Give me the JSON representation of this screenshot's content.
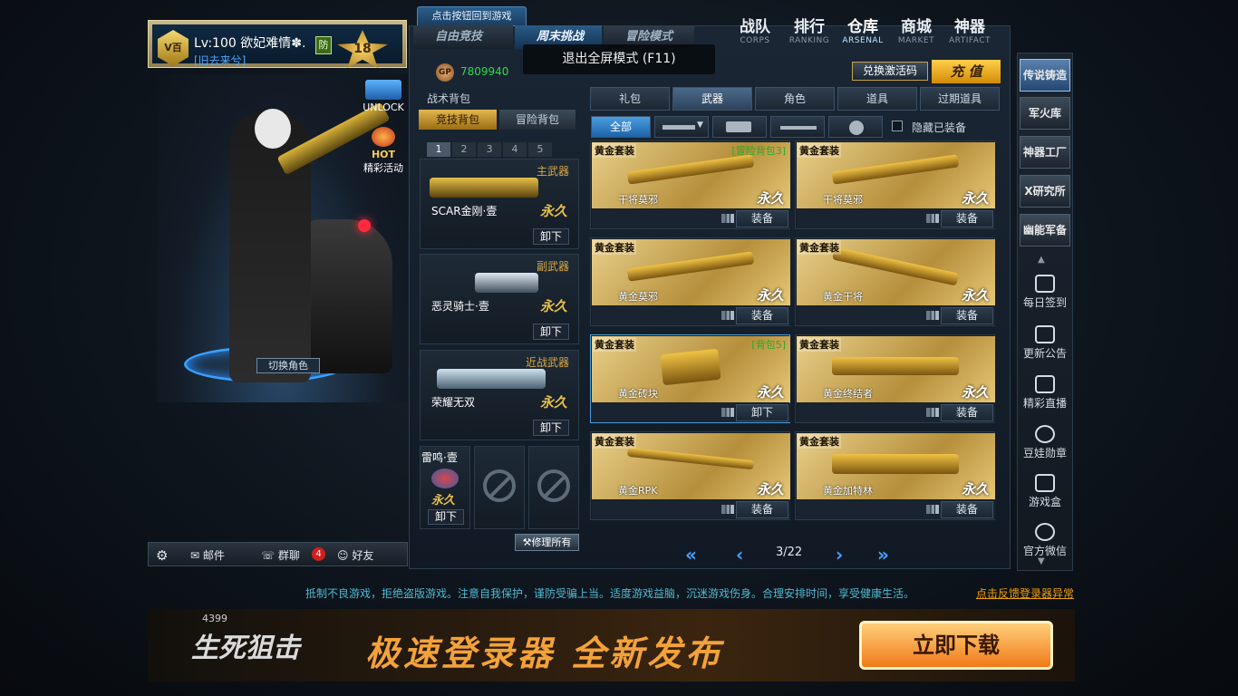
{
  "profile": {
    "rank_label": "V百",
    "level": "Lv:100 欲妃难情✽.",
    "subtitle": "[旧去来兮]",
    "fang": "防",
    "star": "18"
  },
  "left_icons": {
    "unlock": "UNLOCK",
    "hot": "HOT",
    "hot_label": "精彩活动"
  },
  "switch_role": "切换角色",
  "leftbar": {
    "mail": "邮件",
    "group": "群聊",
    "group_count": "4",
    "friends": "好友"
  },
  "tooltip": "点击按钮回到游戏",
  "mode_tabs": [
    "自由竞技",
    "周末挑战",
    "冒险模式"
  ],
  "fullscreen_msg": "退出全屏模式 (F11)",
  "nav": [
    {
      "cn": "战队",
      "en": "CORPS"
    },
    {
      "cn": "排行",
      "en": "RANKING"
    },
    {
      "cn": "仓库",
      "en": "ARSENAL"
    },
    {
      "cn": "商城",
      "en": "MARKET"
    },
    {
      "cn": "神器",
      "en": "ARTIFACT"
    }
  ],
  "currency": {
    "gp": "GP",
    "amount": "7809940"
  },
  "redeem": "兑换激活码",
  "recharge": "充 值",
  "tabs": [
    "礼包",
    "武器",
    "角色",
    "道具",
    "过期道具"
  ],
  "filter": {
    "all": "全部",
    "hide": "隐藏已装备"
  },
  "backpack": {
    "title": "战术背包",
    "tabs": [
      "竞技背包",
      "冒险背包"
    ],
    "pages": [
      "1",
      "2",
      "3",
      "4",
      "5"
    ],
    "slots": [
      {
        "cat": "主武器",
        "name": "SCAR金刚·壹",
        "forever": "永久",
        "btn": "卸下"
      },
      {
        "cat": "副武器",
        "name": "恶灵骑士·壹",
        "forever": "永久",
        "btn": "卸下"
      },
      {
        "cat": "近战武器",
        "name": "荣耀无双",
        "forever": "永久",
        "btn": "卸下"
      }
    ],
    "grenade": {
      "name": "雷鸣·壹",
      "forever": "永久",
      "btn": "卸下"
    },
    "repair": "修理所有"
  },
  "items": [
    {
      "tag": "黄金套装",
      "tag2": "[冒险背包3]",
      "name": "干将莫邪",
      "forever": "永久",
      "btn": "装备"
    },
    {
      "tag": "黄金套装",
      "tag2": "",
      "name": "干将莫邪",
      "forever": "永久",
      "btn": "装备"
    },
    {
      "tag": "黄金套装",
      "tag2": "",
      "name": "黄金莫邪",
      "forever": "永久",
      "btn": "装备"
    },
    {
      "tag": "黄金套装",
      "tag2": "",
      "name": "黄金干将",
      "forever": "永久",
      "btn": "装备"
    },
    {
      "tag": "黄金套装",
      "tag2": "[背包5]",
      "name": "黄金砖块",
      "forever": "永久",
      "btn": "卸下"
    },
    {
      "tag": "黄金套装",
      "tag2": "",
      "name": "黄金终结者",
      "forever": "永久",
      "btn": "装备"
    },
    {
      "tag": "黄金套装",
      "tag2": "",
      "name": "黄金RPK",
      "forever": "永久",
      "btn": "装备"
    },
    {
      "tag": "黄金套装",
      "tag2": "",
      "name": "黄金加特林",
      "forever": "永久",
      "btn": "装备"
    }
  ],
  "pager": {
    "page": "3/22"
  },
  "rightbar": {
    "buttons": [
      "传说铸造",
      "军火库",
      "神器工厂",
      "X研究所",
      "幽能军备"
    ],
    "links": [
      "每日签到",
      "更新公告",
      "精彩直播",
      "豆娃勋章",
      "游戏盒",
      "官方微信"
    ]
  },
  "notice": "抵制不良游戏，拒绝盗版游戏。注意自我保护，谨防受骗上当。适度游戏益脑，沉迷游戏伤身。合理安排时间，享受健康生活。",
  "feedback": "点击反馈登录器异常",
  "banner": {
    "brand": "4399",
    "logo": "生死狙击",
    "slogan": "极速登录器 全新发布",
    "download": "立即下载"
  }
}
